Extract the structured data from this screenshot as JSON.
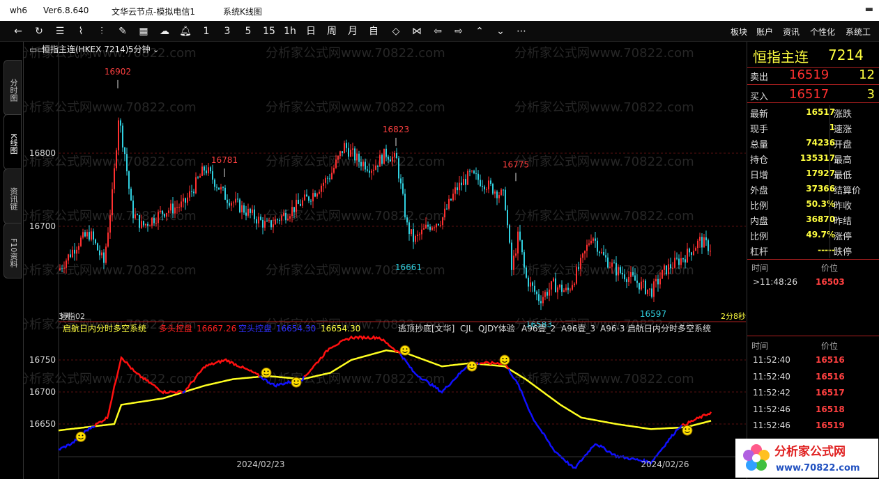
{
  "titlebar": {
    "app": "wh6",
    "version": "Ver6.8.640",
    "server": "文华云节点-模拟电信1",
    "page": "系统K线图"
  },
  "toolbar": {
    "periods": [
      "1",
      "3",
      "5",
      "15",
      "1h",
      "日",
      "周",
      "月",
      "自"
    ],
    "menus": [
      "板块",
      "账户",
      "资讯",
      "个性化",
      "系统工"
    ]
  },
  "left_tabs": [
    "分时图",
    "K线图",
    "资讯链",
    "F10资料"
  ],
  "chart": {
    "instrument": "恒指主连(HKEX 7214)",
    "period": "5分钟",
    "watermark": "分析家公式网www.70822.com",
    "price_axis": [
      "16800",
      "16700"
    ],
    "indicator_axis": [
      "16750",
      "16700",
      "16650"
    ],
    "high_labels": [
      "16902",
      "16781",
      "16823",
      "16775"
    ],
    "low_labels": [
      "16661",
      "16583",
      "16597"
    ],
    "left_marker": "3天",
    "sub_label": "恒指02",
    "countdown": "2分8秒",
    "dates": [
      "2024/02/23",
      "2024/02/26"
    ],
    "indicator": {
      "name": "启航日内分时多空系统",
      "bull_label": "多头控盘",
      "bull_value": "16667.26",
      "bear_label": "空头控盘",
      "bear_value": "16654.30",
      "mid_value": "16654.30",
      "others": [
        "逃顶抄底[文华]",
        "CJL",
        "QJDY体验",
        "A96壹_2",
        "A96壹_3",
        "A96-3",
        "启航日内分时多空系统"
      ]
    },
    "colors": {
      "up": "#ff3030",
      "down": "#30d0e0",
      "bull": "#ff1010",
      "bear": "#1010ff",
      "mid": "#ffff20"
    }
  },
  "quote": {
    "name": "恒指主连",
    "code": "7214",
    "ask_label": "卖出",
    "ask": "16519",
    "ask_vol": "12",
    "bid_label": "买入",
    "bid": "16517",
    "bid_vol": "3",
    "rows": [
      {
        "l": "最新",
        "v": "16517",
        "r": "涨跌"
      },
      {
        "l": "现手",
        "v": "1",
        "r": "速涨"
      },
      {
        "l": "总量",
        "v": "74236",
        "r": "开盘"
      },
      {
        "l": "持仓",
        "v": "135317",
        "r": "最高"
      },
      {
        "l": "日增",
        "v": "17927",
        "r": "最低"
      },
      {
        "l": "外盘",
        "v": "37366",
        "r": "结算价"
      },
      {
        "l": "比例",
        "v": "50.3%",
        "r": "昨收"
      },
      {
        "l": "内盘",
        "v": "36870",
        "r": "昨结"
      },
      {
        "l": "比例",
        "v": "49.7%",
        "r": "涨停"
      },
      {
        "l": "杠杆",
        "v": "-----",
        "r": "跌停"
      }
    ],
    "time_label": "时间",
    "price_label": "价位",
    "ticks1": [
      {
        "t": ">11:48:26",
        "p": "16503"
      }
    ],
    "ticks2": [
      {
        "t": "11:52:40",
        "p": "16516"
      },
      {
        "t": "11:52:40",
        "p": "16516"
      },
      {
        "t": "11:52:42",
        "p": "16517"
      },
      {
        "t": "11:52:46",
        "p": "16518"
      },
      {
        "t": "11:52:46",
        "p": "16519"
      }
    ]
  },
  "logo": {
    "text": "分析家公式网",
    "url": "www.70822.com"
  }
}
